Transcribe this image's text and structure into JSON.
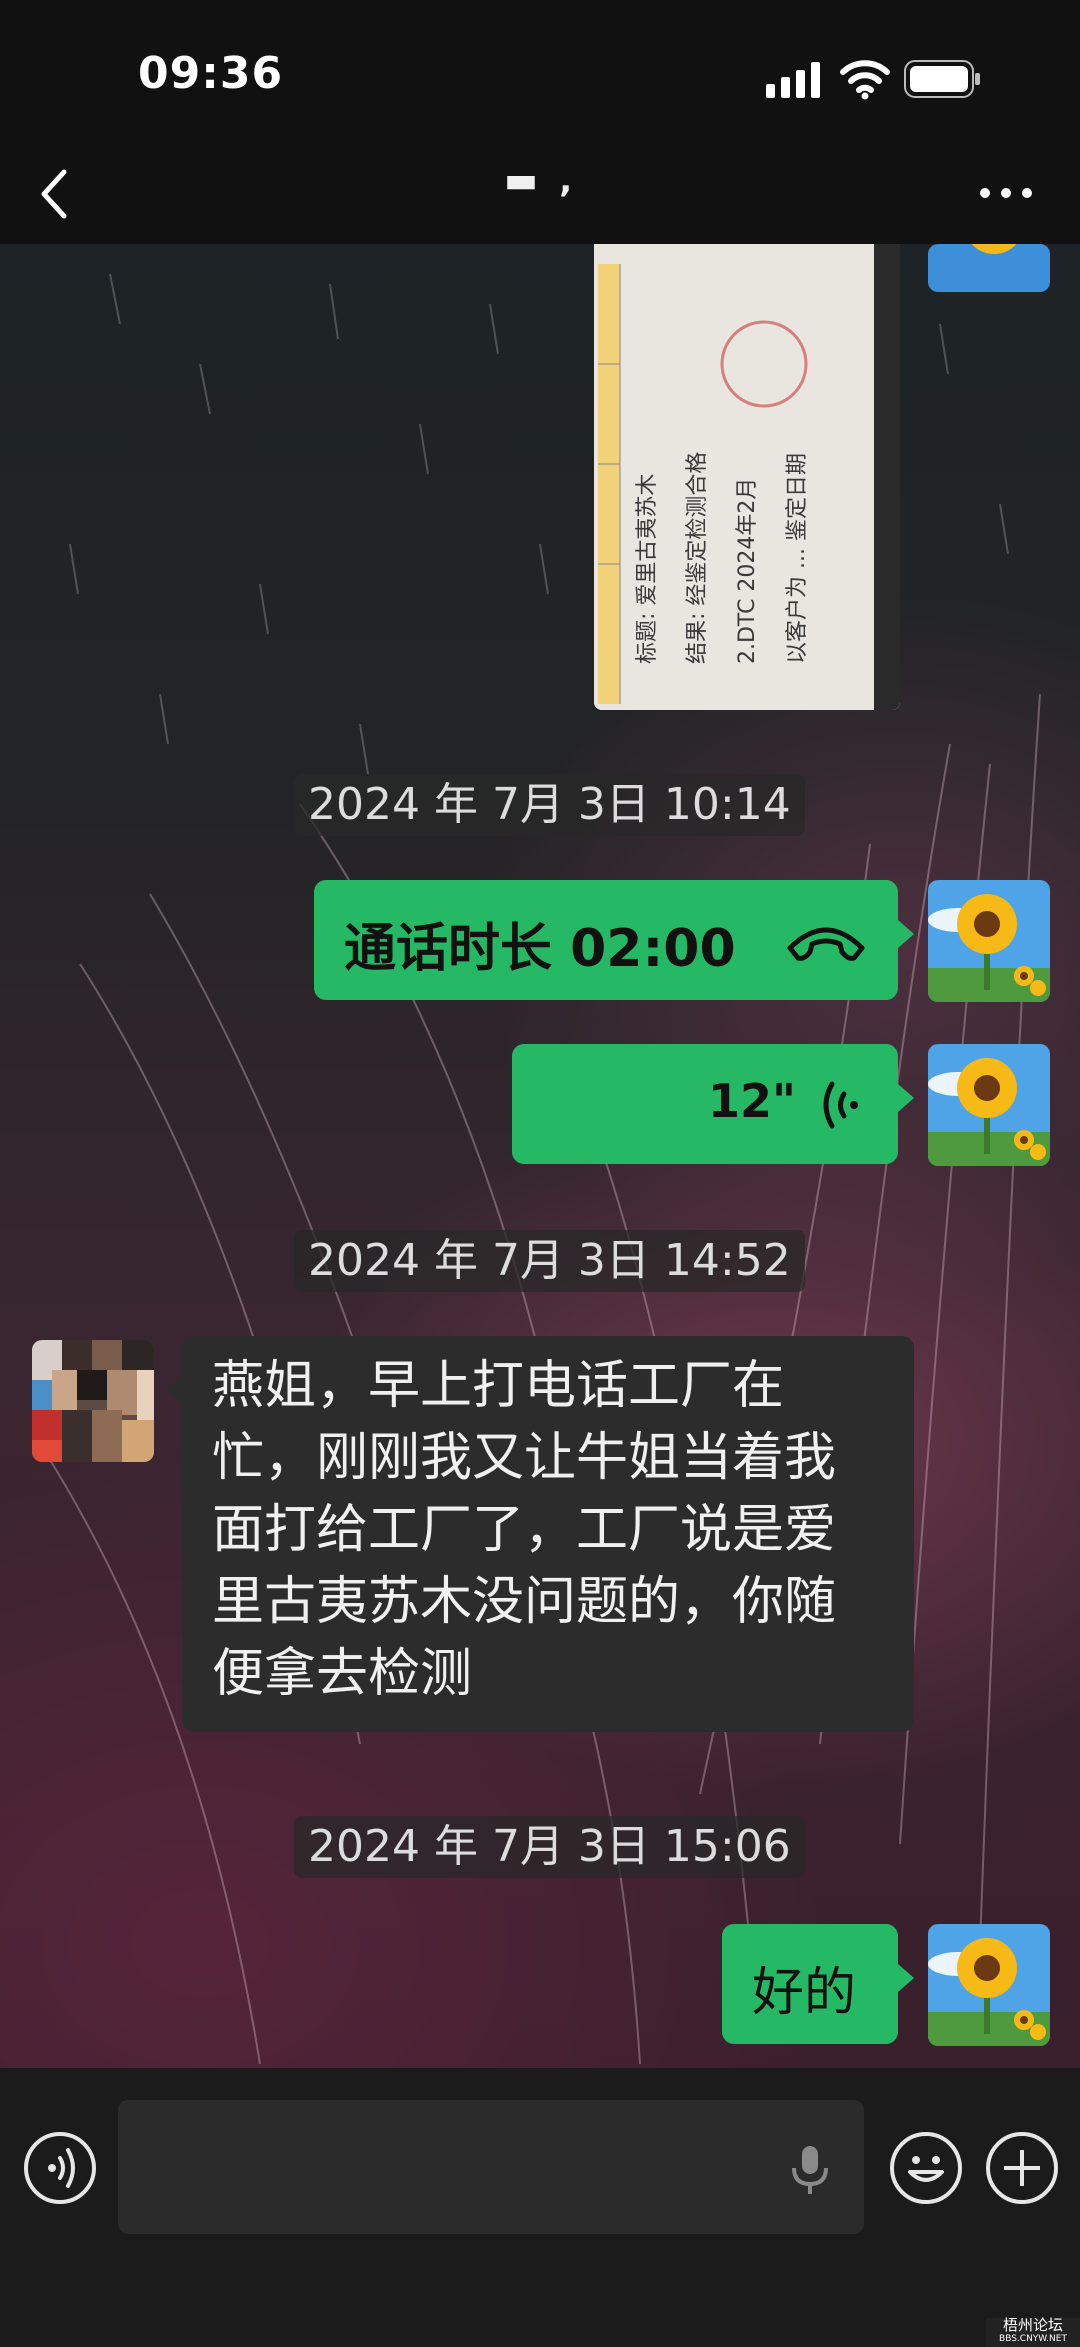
{
  "status_bar": {
    "time": "09:36"
  },
  "header": {
    "contact_name": "▬ ‚"
  },
  "messages": {
    "call": {
      "label": "通话时长 02:00"
    },
    "voice": {
      "duration": "12\""
    },
    "incoming": {
      "text": "燕姐，早上打电话工厂在忙，刚刚我又让牛姐当着我面打给工厂了，工厂说是爱里古夷苏木没问题的，你随便拿去检测"
    },
    "reply": {
      "text": "好的"
    }
  },
  "timestamps": {
    "t1": "2024 年 7月 3日 10:14",
    "t2": "2024 年 7月 3日 14:52",
    "t3": "2024 年 7月 3日 15:06"
  },
  "image_note": {
    "line1": "标题: 爱里古夷苏木",
    "line2": "结果: 经鉴定检测合格",
    "line3": "2.DTC 2024年2月",
    "line4": "以客户为 ... 鉴定日期"
  },
  "input": {
    "placeholder": ""
  },
  "icons": {
    "back": "chevron-left-icon",
    "more": "more-dots-icon",
    "phone": "phone-handset-icon",
    "voice": "voice-wave-icon",
    "voice_toggle": "voice-mode-icon",
    "mic": "microphone-icon",
    "emoji": "emoji-icon",
    "plus": "plus-icon"
  },
  "watermark": {
    "line1": "梧州论坛",
    "line2": "BBS.CNYW.NET"
  },
  "colors": {
    "bubble_out": "#25b965",
    "bubble_in": "#2c2c2c",
    "background": "#121212"
  }
}
